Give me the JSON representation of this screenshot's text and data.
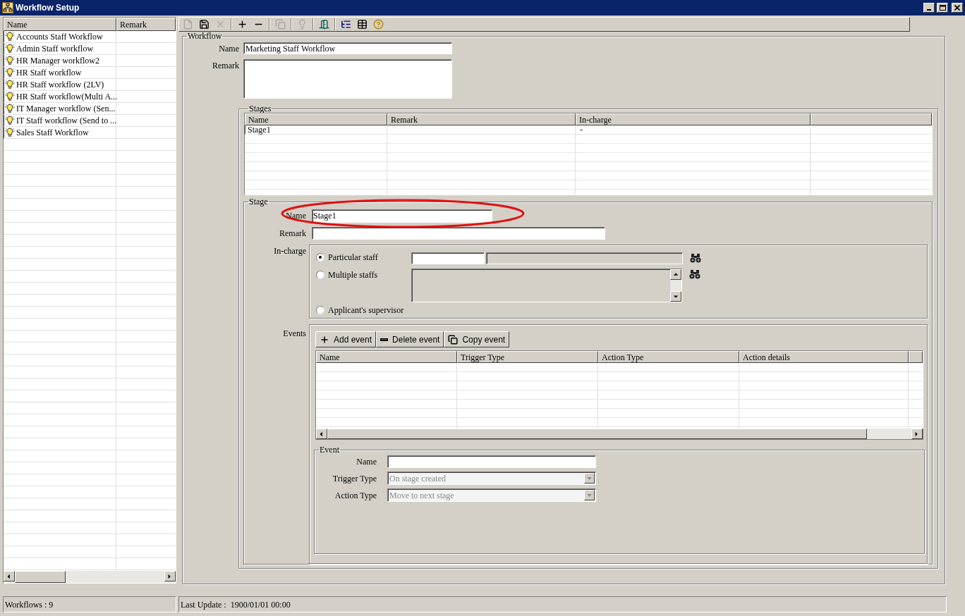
{
  "window": {
    "title": "Workflow Setup"
  },
  "workflow_list": {
    "columns": [
      "Name",
      "Remark"
    ],
    "rows": [
      {
        "name": "Accounts Staff Workflow"
      },
      {
        "name": "Admin Staff workflow"
      },
      {
        "name": "HR Manager workflow2"
      },
      {
        "name": "HR Staff workflow"
      },
      {
        "name": "HR Staff workflow (2LV)"
      },
      {
        "name": "HR Staff workflow(Multi A..."
      },
      {
        "name": "IT Manager workflow (Sen..."
      },
      {
        "name": "IT Staff workflow (Send to ..."
      },
      {
        "name": "Sales Staff Workflow"
      }
    ]
  },
  "toolbar": [
    {
      "kind": "new",
      "disabled": true
    },
    {
      "kind": "save",
      "disabled": false
    },
    {
      "kind": "delete",
      "disabled": true
    },
    {
      "kind": "add",
      "disabled": false
    },
    {
      "kind": "remove",
      "disabled": false
    },
    {
      "kind": "copy",
      "disabled": true
    },
    {
      "kind": "hint",
      "disabled": true
    },
    {
      "kind": "exit",
      "disabled": false
    },
    {
      "kind": "tree",
      "disabled": false
    },
    {
      "kind": "grid",
      "disabled": false
    },
    {
      "kind": "help",
      "disabled": false
    }
  ],
  "workflow": {
    "legend": "Workflow",
    "name_label": "Name",
    "name_value": "Marketing Staff Workflow",
    "remark_label": "Remark"
  },
  "stages": {
    "legend": "Stages",
    "columns": [
      "Name",
      "Remark",
      "In-charge"
    ],
    "rows": [
      {
        "name": "Stage1",
        "in_charge": "-"
      }
    ]
  },
  "stage": {
    "legend": "Stage",
    "name_label": "Name",
    "name_value": "Stage1",
    "name_circled": true,
    "remark_label": "Remark",
    "in_charge_label": "In-charge",
    "in_charge_options": [
      {
        "label": "Particular staff",
        "kind": "single",
        "selected": true
      },
      {
        "label": "Multiple staffs",
        "kind": "multiple",
        "selected": false
      },
      {
        "label": "Applicant's supervisor",
        "kind": "none",
        "selected": false
      }
    ],
    "events_label": "Events",
    "event_buttons": [
      {
        "label": "Add event",
        "kind": "add"
      },
      {
        "label": "Delete event",
        "kind": "remove"
      },
      {
        "label": "Copy event",
        "kind": "copy"
      }
    ],
    "event_columns": [
      "Name",
      "Trigger Type",
      "Action Type",
      "Action details"
    ],
    "event": {
      "legend": "Event",
      "fields": [
        {
          "label": "Name",
          "kind": "text",
          "disabled": false
        },
        {
          "label": "Trigger Type",
          "kind": "select",
          "value": "On stage created",
          "disabled": true
        },
        {
          "label": "Action Type",
          "kind": "select",
          "value": "Move to next stage",
          "disabled": true
        }
      ]
    }
  },
  "status_bar": [
    "Workflows : 9",
    "Last Update :  1900/01/01 00:00"
  ]
}
